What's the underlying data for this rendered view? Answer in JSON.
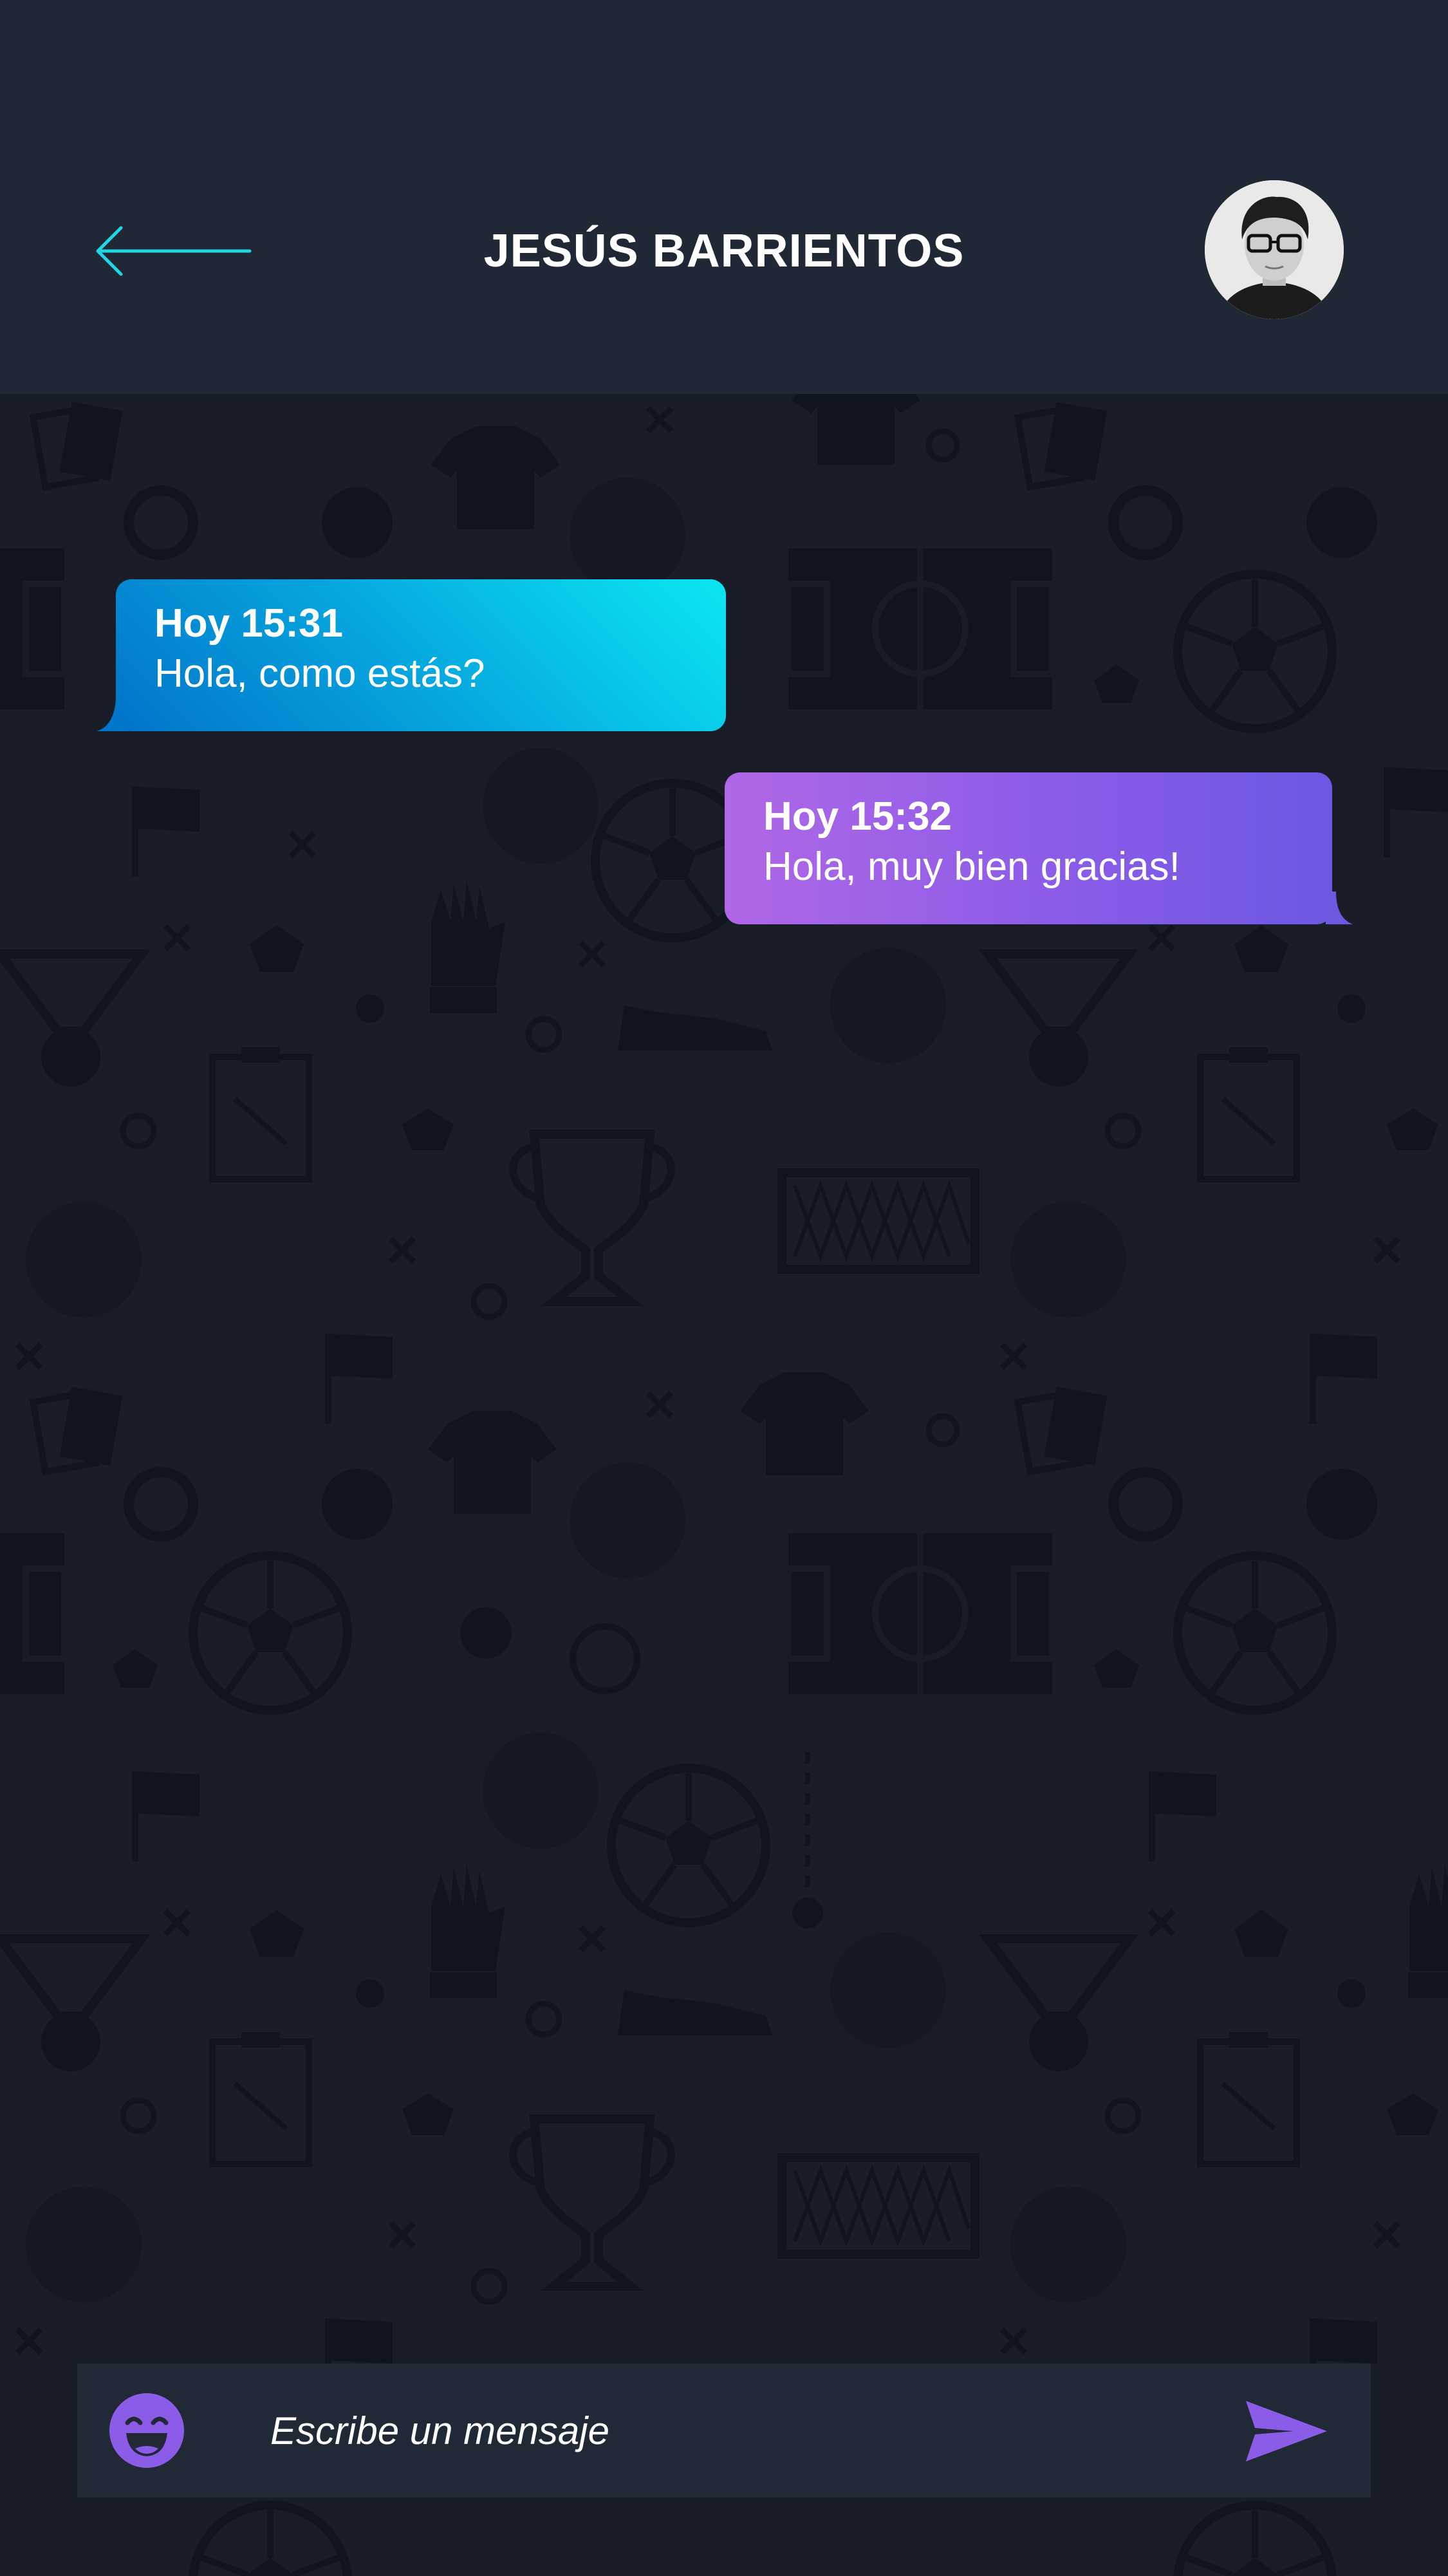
{
  "header": {
    "title": "JESÚS BARRIENTOS",
    "back_icon": "arrow-left-icon",
    "avatar_icon": "contact-avatar"
  },
  "messages": [
    {
      "direction": "incoming",
      "time": "Hoy 15:31",
      "text": "Hola, como estás?"
    },
    {
      "direction": "outgoing",
      "time": "Hoy 15:32",
      "text": "Hola, muy bien gracias!"
    }
  ],
  "composer": {
    "placeholder": "Escribe un mensaje",
    "emoji_icon": "emoji-icon",
    "send_icon": "send-icon"
  },
  "colors": {
    "header_background": "#202836",
    "chat_background": "#181d28",
    "back_arrow": "#1fd6e3",
    "incoming_bubble_start": "#0be7f1",
    "incoming_bubble_end": "#0273c8",
    "outgoing_bubble_start": "#b067e6",
    "outgoing_bubble_end": "#6d58e2",
    "accent_purple": "#8b5ce8"
  }
}
